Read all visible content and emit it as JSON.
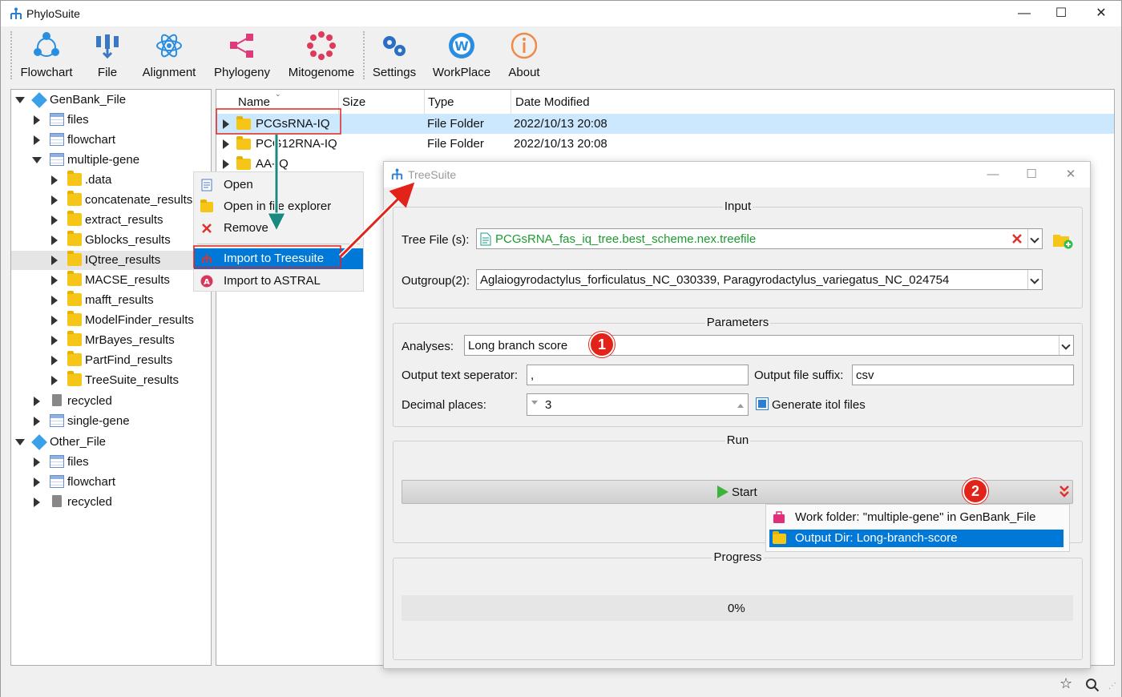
{
  "app": {
    "title": "PhyloSuite"
  },
  "window_controls": {
    "minimize": "—",
    "maximize": "☐",
    "close": "✕"
  },
  "toolbar": {
    "items": [
      {
        "label": "Flowchart",
        "icon": "flowchart-icon"
      },
      {
        "label": "File",
        "icon": "file-icon"
      },
      {
        "label": "Alignment",
        "icon": "alignment-icon"
      },
      {
        "label": "Phylogeny",
        "icon": "phylogeny-icon"
      },
      {
        "label": "Mitogenome",
        "icon": "mitogenome-icon"
      },
      {
        "label": "Settings",
        "icon": "settings-icon"
      },
      {
        "label": "WorkPlace",
        "icon": "workplace-icon"
      },
      {
        "label": "About",
        "icon": "about-icon"
      }
    ]
  },
  "tree": {
    "items": [
      {
        "label": "GenBank_File"
      },
      {
        "label": "files"
      },
      {
        "label": "flowchart"
      },
      {
        "label": "multiple-gene"
      },
      {
        "label": ".data"
      },
      {
        "label": "concatenate_results"
      },
      {
        "label": "extract_results"
      },
      {
        "label": "Gblocks_results"
      },
      {
        "label": "IQtree_results"
      },
      {
        "label": "MACSE_results"
      },
      {
        "label": "mafft_results"
      },
      {
        "label": "ModelFinder_results"
      },
      {
        "label": "MrBayes_results"
      },
      {
        "label": "PartFind_results"
      },
      {
        "label": "TreeSuite_results"
      },
      {
        "label": "recycled"
      },
      {
        "label": "single-gene"
      },
      {
        "label": "Other_File"
      },
      {
        "label": "files"
      },
      {
        "label": "flowchart"
      },
      {
        "label": "recycled"
      }
    ]
  },
  "file_list": {
    "headers": {
      "name": "Name",
      "size": "Size",
      "type": "Type",
      "date": "Date Modified"
    },
    "rows": [
      {
        "name": "PCGsRNA-IQ",
        "type": "File Folder",
        "date": "2022/10/13 20:08"
      },
      {
        "name": "PCG12RNA-IQ",
        "type": "File Folder",
        "date": "2022/10/13 20:08"
      },
      {
        "name": "AA-IQ",
        "type": "",
        "date": ""
      }
    ]
  },
  "context_menu": {
    "items": [
      {
        "label": "Open"
      },
      {
        "label": "Open in file explorer"
      },
      {
        "label": "Remove"
      },
      {
        "label": "Import to Treesuite"
      },
      {
        "label": "Import to ASTRAL"
      }
    ]
  },
  "dialog": {
    "title": "TreeSuite",
    "input": {
      "group_title": "Input",
      "tree_file_label": "Tree File (s):",
      "tree_file_value": "PCGsRNA_fas_iq_tree.best_scheme.nex.treefile",
      "outgroup_label": "Outgroup(2):",
      "outgroup_value": "Aglaiogyrodactylus_forficulatus_NC_030339, Paragyrodactylus_variegatus_NC_024754"
    },
    "parameters": {
      "group_title": "Parameters",
      "analyses_label": "Analyses:",
      "analyses_value": "Long branch score",
      "separator_label": "Output text seperator:",
      "separator_value": ",",
      "suffix_label": "Output file suffix:",
      "suffix_value": "csv",
      "decimal_label": "Decimal places:",
      "decimal_value": "3",
      "itol_label": "Generate itol files",
      "itol_checked": true
    },
    "run": {
      "group_title": "Run",
      "start_label": "Start",
      "menu": [
        {
          "label": "Work folder: \"multiple-gene\" in GenBank_File"
        },
        {
          "label": "Output Dir: Long-branch-score"
        }
      ]
    },
    "progress": {
      "group_title": "Progress",
      "value_text": "0%",
      "value": 0
    }
  },
  "badges": {
    "one": "1",
    "two": "2"
  },
  "colors": {
    "accent": "#0078d7",
    "selection": "#cce8ff",
    "annotation": "#e2231a",
    "arrow_teal": "#1a8a80",
    "green_text": "#1a9c2e"
  }
}
